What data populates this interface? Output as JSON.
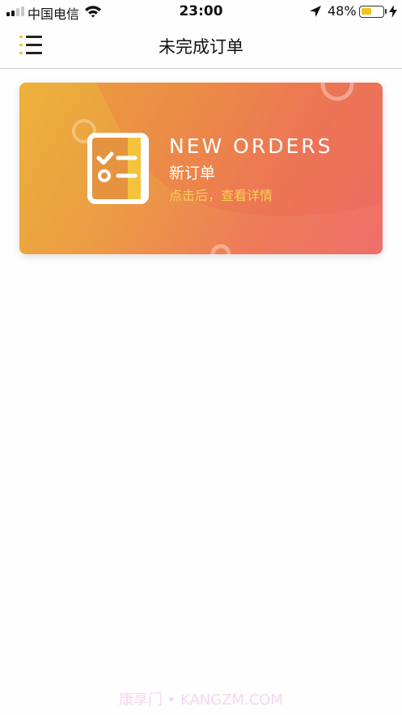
{
  "status_bar": {
    "carrier": "中国电信",
    "time": "23:00",
    "battery_percent": "48%",
    "battery_level": 0.48,
    "icons": [
      "signal-icon",
      "wifi-icon",
      "location-arrow-icon",
      "battery-icon",
      "charging-bolt-icon"
    ]
  },
  "nav": {
    "title": "未完成订单",
    "menu_icon": "list-menu-icon"
  },
  "order_card": {
    "title_en": "NEW ORDERS",
    "title_cn": "新订单",
    "hint": "点击后，查看详情",
    "icon": "checklist-icon",
    "colors": {
      "gradient_start": "#edb23a",
      "gradient_end": "#ef6f6a",
      "hint": "#f7cf57"
    }
  },
  "watermark": "康享门 • KANGZM.COM",
  "colors": {
    "accent_yellow": "#f2c22a",
    "divider": "#d6d6d6"
  }
}
